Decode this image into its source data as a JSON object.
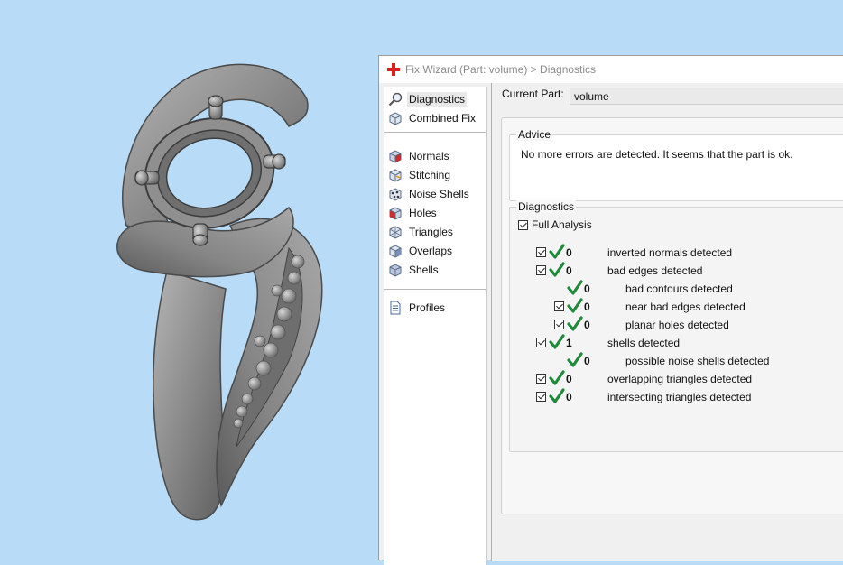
{
  "window": {
    "title": "Fix Wizard (Part: volume) > Diagnostics"
  },
  "nav": {
    "items": [
      {
        "label": "Diagnostics",
        "icon": "magnifier-icon",
        "selected": true
      },
      {
        "label": "Combined Fix",
        "icon": "cube-icon"
      },
      {
        "label": "Normals",
        "icon": "normals-cube-icon"
      },
      {
        "label": "Stitching",
        "icon": "stitching-cube-icon"
      },
      {
        "label": "Noise Shells",
        "icon": "noise-shells-icon"
      },
      {
        "label": "Holes",
        "icon": "holes-cube-icon"
      },
      {
        "label": "Triangles",
        "icon": "triangles-icon"
      },
      {
        "label": "Overlaps",
        "icon": "overlaps-icon"
      },
      {
        "label": "Shells",
        "icon": "shells-icon"
      },
      {
        "label": "Profiles",
        "icon": "document-icon"
      }
    ]
  },
  "current_part": {
    "label": "Current Part:",
    "value": "volume"
  },
  "advice": {
    "title": "Advice",
    "text": "No more errors are detected. It seems that the part is ok."
  },
  "diagnostics": {
    "title": "Diagnostics",
    "full_analysis_label": "Full Analysis",
    "full_analysis_checked": true,
    "rows": [
      {
        "count": "0",
        "label": "inverted normals detected",
        "checkbox": true,
        "indent": 0
      },
      {
        "count": "0",
        "label": "bad edges detected",
        "checkbox": true,
        "indent": 0
      },
      {
        "count": "0",
        "label": "bad contours detected",
        "checkbox": false,
        "indent": 1
      },
      {
        "count": "0",
        "label": "near bad edges detected",
        "checkbox": true,
        "indent": 1
      },
      {
        "count": "0",
        "label": "planar holes detected",
        "checkbox": true,
        "indent": 1
      },
      {
        "count": "1",
        "label": "shells detected",
        "checkbox": true,
        "indent": 0
      },
      {
        "count": "0",
        "label": "possible noise shells detected",
        "checkbox": false,
        "indent": 1
      },
      {
        "count": "0",
        "label": "overlapping triangles detected",
        "checkbox": true,
        "indent": 0
      },
      {
        "count": "0",
        "label": "intersecting triangles detected",
        "checkbox": true,
        "indent": 0
      }
    ]
  },
  "colors": {
    "viewport_background": "#b8dcf8",
    "model_gray": "#8c8c8c",
    "check_green": "#1f8a3a",
    "title_icon_red": "#d81e1e"
  }
}
